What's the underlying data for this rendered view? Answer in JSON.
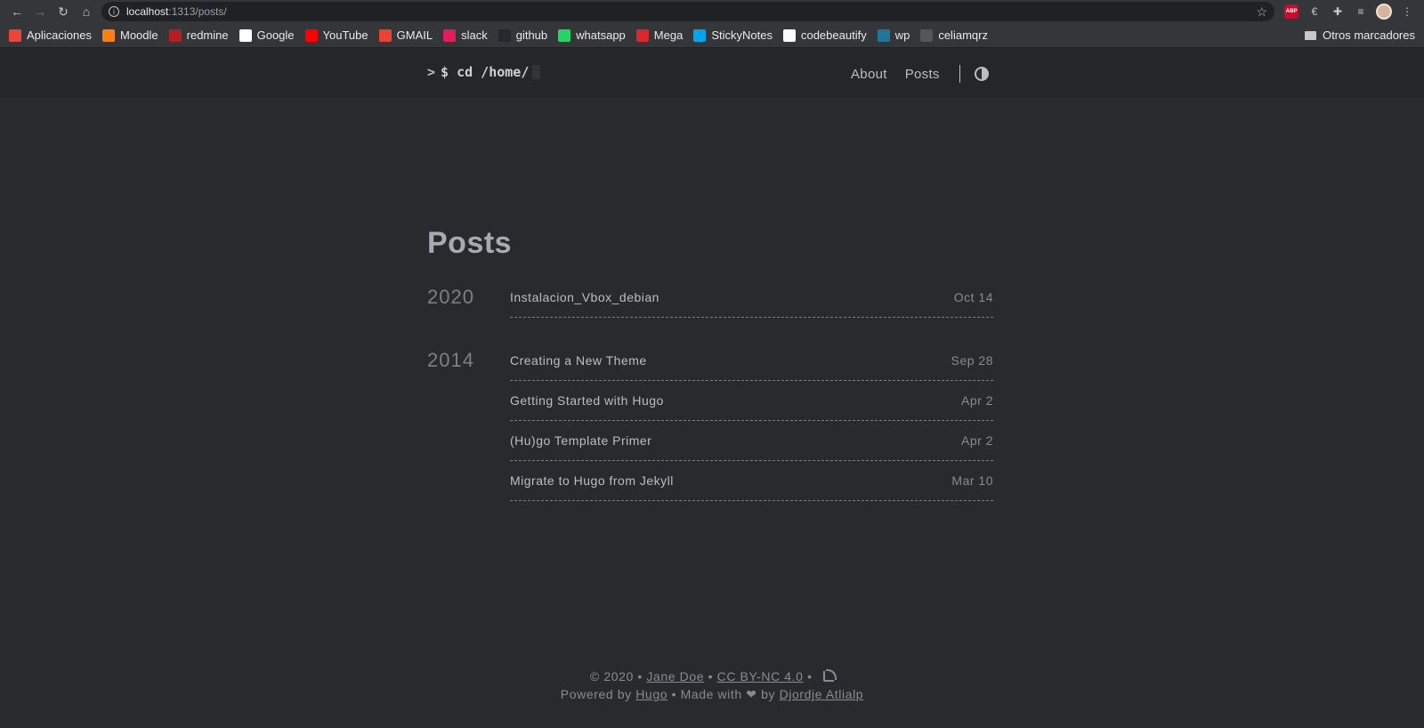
{
  "browser": {
    "url_host": "localhost",
    "url_path": ":1313/posts/",
    "bookmarks": [
      {
        "label": "Aplicaciones",
        "icon": "apps-grid-icon",
        "color": "#e8453c"
      },
      {
        "label": "Moodle",
        "icon": "moodle-icon",
        "color": "#f98012"
      },
      {
        "label": "redmine",
        "icon": "redmine-icon",
        "color": "#b32024"
      },
      {
        "label": "Google",
        "icon": "google-icon",
        "color": "#ffffff"
      },
      {
        "label": "YouTube",
        "icon": "youtube-icon",
        "color": "#ff0000"
      },
      {
        "label": "GMAIL",
        "icon": "gmail-icon",
        "color": "#ea4335"
      },
      {
        "label": "slack",
        "icon": "slack-icon",
        "color": "#e01e5a"
      },
      {
        "label": "github",
        "icon": "github-icon",
        "color": "#24292e"
      },
      {
        "label": "whatsapp",
        "icon": "whatsapp-icon",
        "color": "#25d366"
      },
      {
        "label": "Mega",
        "icon": "mega-icon",
        "color": "#d9272e"
      },
      {
        "label": "StickyNotes",
        "icon": "stickynotes-icon",
        "color": "#00a4ef"
      },
      {
        "label": "codebeautify",
        "icon": "codebeautify-icon",
        "color": "#ffffff"
      },
      {
        "label": "wp",
        "icon": "wordpress-icon",
        "color": "#21759b"
      },
      {
        "label": "celiamqrz",
        "icon": "link-icon",
        "color": "#555555"
      }
    ],
    "other_bookmarks": "Otros marcadores"
  },
  "site": {
    "logo_prompt": ">",
    "logo_text": "$ cd /home/",
    "nav": [
      {
        "label": "About"
      },
      {
        "label": "Posts"
      }
    ]
  },
  "page": {
    "title": "Posts",
    "groups": [
      {
        "year": "2020",
        "posts": [
          {
            "title": "Instalacion_Vbox_debian",
            "date": "Oct 14"
          }
        ]
      },
      {
        "year": "2014",
        "posts": [
          {
            "title": "Creating a New Theme",
            "date": "Sep 28"
          },
          {
            "title": "Getting Started with Hugo",
            "date": "Apr 2"
          },
          {
            "title": "(Hu)go Template Primer",
            "date": "Apr 2"
          },
          {
            "title": "Migrate to Hugo from Jekyll",
            "date": "Mar 10"
          }
        ]
      }
    ]
  },
  "footer": {
    "copyright": "© 2020 •",
    "author": "Jane Doe",
    "sep1": "•",
    "license": "CC BY-NC 4.0",
    "sep2": "•",
    "powered_prefix": "Powered by",
    "hugo": "Hugo",
    "made_with": "•  Made with ❤ by",
    "theme_author": "Djordje Atlialp"
  }
}
